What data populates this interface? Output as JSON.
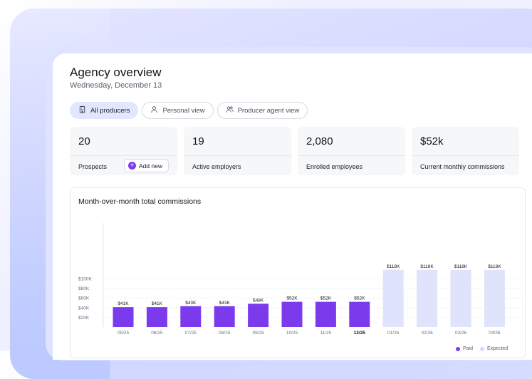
{
  "header": {
    "title": "Agency overview",
    "date": "Wednesday, December 13"
  },
  "tabs": [
    {
      "label": "All producers",
      "icon": "building-icon",
      "active": true
    },
    {
      "label": "Personal view",
      "icon": "person-icon",
      "active": false
    },
    {
      "label": "Producer agent view",
      "icon": "people-icon",
      "active": false
    }
  ],
  "stats": [
    {
      "value": "20",
      "label": "Prospects",
      "action": "Add new"
    },
    {
      "value": "19",
      "label": "Active employers"
    },
    {
      "value": "2,080",
      "label": "Enrolled employees"
    },
    {
      "value": "$52k",
      "label": "Current monthly commissions"
    }
  ],
  "colors": {
    "accent": "#7c3aed",
    "expected": "#dfe3fb",
    "active_tab": "#e3e6ff"
  },
  "chart_data": {
    "type": "bar",
    "title": "Month-over-month total commissions",
    "categories": [
      "05/25",
      "06/25",
      "07/25",
      "08/25",
      "09/25",
      "10/25",
      "11/25",
      "12/25",
      "01/26",
      "02/26",
      "03/26",
      "04/26"
    ],
    "series": [
      {
        "name": "Paid",
        "color": "#7c3aed",
        "values": [
          41,
          41,
          43,
          43,
          48,
          52,
          52,
          52,
          null,
          null,
          null,
          null
        ],
        "labels": [
          "$41K",
          "$41K",
          "$43K",
          "$43K",
          "$48K",
          "$52K",
          "$52K",
          "$52K",
          "",
          "",
          "",
          ""
        ]
      },
      {
        "name": "Expected",
        "color": "#dfe3fb",
        "values": [
          null,
          null,
          null,
          null,
          null,
          null,
          null,
          null,
          118,
          118,
          118,
          118
        ],
        "labels": [
          "",
          "",
          "",
          "",
          "",
          "",
          "",
          "",
          "$118K",
          "$118K",
          "$118K",
          "$118K"
        ]
      }
    ],
    "y_ticks": [
      "$100K",
      "$80K",
      "$60K",
      "$40K",
      "$20K"
    ],
    "y_tick_values": [
      100,
      80,
      60,
      40,
      20
    ],
    "ylim": [
      0,
      100
    ],
    "grid": true,
    "legend": "bottom-right",
    "highlight_category": "12/25"
  }
}
